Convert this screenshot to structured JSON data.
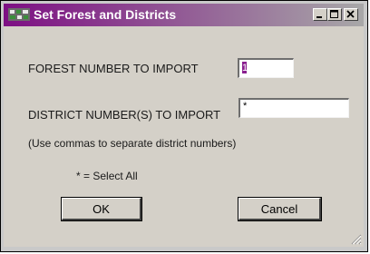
{
  "window": {
    "title": "Set Forest and Districts",
    "icon": "app-icon",
    "title_gradient_start": "#7d0f83",
    "controls": [
      "minimize-icon",
      "maximize-icon",
      "close-icon"
    ]
  },
  "form": {
    "forest_label": "FOREST NUMBER TO IMPORT",
    "forest_value": "1",
    "district_label": "DISTRICT NUMBER(S) TO IMPORT",
    "district_value": "*",
    "hint": "(Use commas to separate district numbers)",
    "select_all_note": "* = Select All"
  },
  "buttons": {
    "ok_label": "OK",
    "cancel_label": "Cancel"
  }
}
